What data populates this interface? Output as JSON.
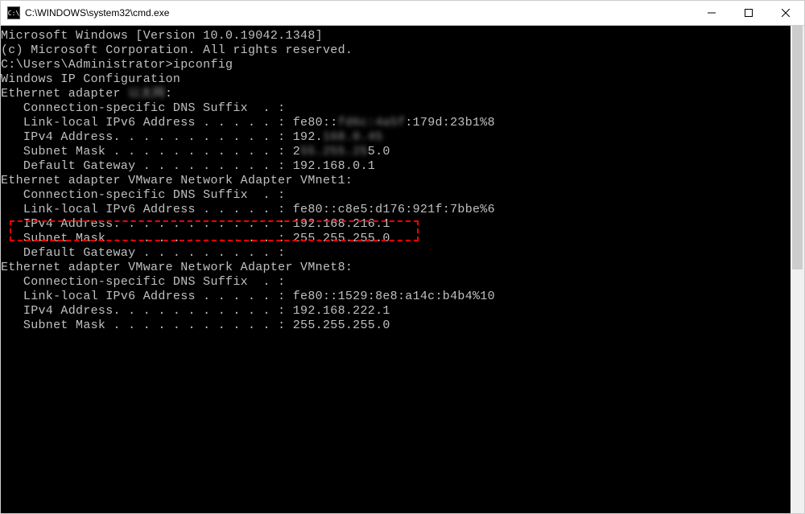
{
  "window": {
    "title": "C:\\WINDOWS\\system32\\cmd.exe",
    "icon_label": "C:\\"
  },
  "terminal": {
    "line1": "Microsoft Windows [Version 10.0.19042.1348]",
    "line2": "(c) Microsoft Corporation. All rights reserved.",
    "blank1": "",
    "prompt_line": "C:\\Users\\Administrator>ipconfig",
    "blank2": "",
    "header": "Windows IP Configuration",
    "blank3": "",
    "blank4": "",
    "eth1_title_prefix": "Ethernet adapter ",
    "eth1_title_name_blurred": "以太网",
    "eth1_title_suffix": ":",
    "blank5": "",
    "eth1_dns": "   Connection-specific DNS Suffix  . :",
    "eth1_ipv6_l": "   Link-local IPv6 Address . . . . . : fe80::",
    "eth1_ipv6_b": "fd6c:4a5f",
    "eth1_ipv6_r": ":179d:23b1%8",
    "eth1_ipv4_l": "   IPv4 Address. . . . . . . . . . . : 192.",
    "eth1_ipv4_b": "168.0.45",
    "eth1_subn_l": "   Subnet Mask . . . . . . . . . . . : 2",
    "eth1_subn_b": "55.255.25",
    "eth1_subn_r": "5.0",
    "eth1_gw": "   Default Gateway . . . . . . . . . : 192.168.0.1",
    "blank6": "",
    "eth2_title": "Ethernet adapter VMware Network Adapter VMnet1:",
    "blank7": "",
    "eth2_dns": "   Connection-specific DNS Suffix  . :",
    "eth2_ipv6": "   Link-local IPv6 Address . . . . . : fe80::c8e5:d176:921f:7bbe%6",
    "eth2_ipv4": "   IPv4 Address. . . . . . . . . . . : 192.168.216.1",
    "eth2_subn": "   Subnet Mask . . . . . . . . . . . : 255.255.255.0",
    "eth2_gw": "   Default Gateway . . . . . . . . . :",
    "blank8": "",
    "eth3_title": "Ethernet adapter VMware Network Adapter VMnet8:",
    "blank9": "",
    "eth3_dns": "   Connection-specific DNS Suffix  . :",
    "eth3_ipv6": "   Link-local IPv6 Address . . . . . : fe80::1529:8e8:a14c:b4b4%10",
    "eth3_ipv4": "   IPv4 Address. . . . . . . . . . . : 192.168.222.1",
    "eth3_subn": "   Subnet Mask . . . . . . . . . . . : 255.255.255.0"
  }
}
